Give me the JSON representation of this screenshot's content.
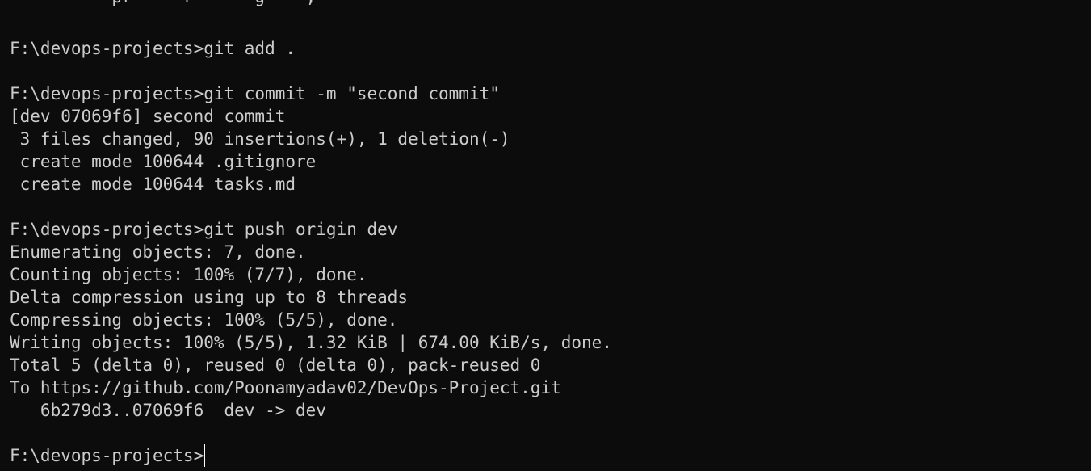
{
  "terminal": {
    "clipped_top_line": "          pr     r      g    ,",
    "lines": [
      "",
      "F:\\devops-projects>git add .",
      "",
      "F:\\devops-projects>git commit -m \"second commit\"",
      "[dev 07069f6] second commit",
      " 3 files changed, 90 insertions(+), 1 deletion(-)",
      " create mode 100644 .gitignore",
      " create mode 100644 tasks.md",
      "",
      "F:\\devops-projects>git push origin dev",
      "Enumerating objects: 7, done.",
      "Counting objects: 100% (7/7), done.",
      "Delta compression using up to 8 threads",
      "Compressing objects: 100% (5/5), done.",
      "Writing objects: 100% (5/5), 1.32 KiB | 674.00 KiB/s, done.",
      "Total 5 (delta 0), reused 0 (delta 0), pack-reused 0",
      "To https://github.com/Poonamyadav02/DevOps-Project.git",
      "   6b279d3..07069f6  dev -> dev",
      ""
    ],
    "prompt": "F:\\devops-projects>"
  }
}
